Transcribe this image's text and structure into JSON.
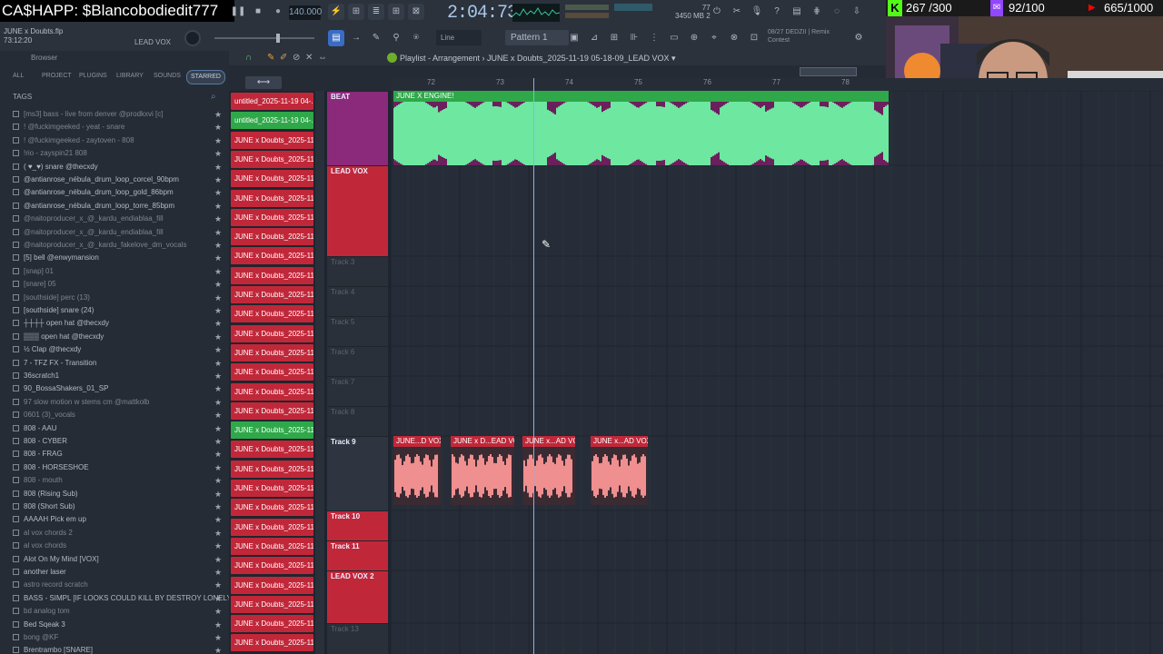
{
  "stream": {
    "cashapp": "CA$HAPP: $Blancobodiedit777",
    "goal1": "267 /300",
    "goal2": "92/100",
    "goal3": "665/1000"
  },
  "transport": {
    "tempo": "140.000",
    "time": "2:04:73",
    "time_label": "M:S:CS",
    "cpu": "3450 MB",
    "cpu2": "2",
    "cpu_top": "77"
  },
  "song": {
    "title": "JUNE x Doubts.flp",
    "elapsed": "73:12:20",
    "channel": "LEAD VOX"
  },
  "toolbar": {
    "snap": "Line",
    "pattern": "Pattern 1",
    "hint_line1": "08/27  DEDZII | Remix",
    "hint_line2": "Contest"
  },
  "browser": {
    "header": "Browser",
    "tabs": [
      "ALL",
      "PROJECT",
      "PLUGINS",
      "LIBRARY",
      "SOUNDS",
      "STARRED"
    ],
    "tags_label": "TAGS",
    "items": [
      {
        "label": "[ms3] bass - live from denver @prodkxvi [c]",
        "dim": true
      },
      {
        "label": "! @fuckimgeeked - yeat - snare",
        "dim": true
      },
      {
        "label": "! @fuckimgeeked - zaytoven - 808",
        "dim": true
      },
      {
        "label": "!rio - zayspin21 808",
        "dim": true
      },
      {
        "label": "( ♥_♥) snare @thecxdy",
        "dim": false
      },
      {
        "label": "@antianrose_nébula_drum_loop_corcel_90bpm",
        "dim": false
      },
      {
        "label": "@antianrose_nébula_drum_loop_gold_86bpm",
        "dim": false
      },
      {
        "label": "@antianrose_nébula_drum_loop_torre_85bpm",
        "dim": false
      },
      {
        "label": "@naitoproducer_x_@_kardu_endiablaa_fill",
        "dim": true
      },
      {
        "label": "@naitoproducer_x_@_kardu_endiablaa_fill",
        "dim": true
      },
      {
        "label": "@naitoproducer_x_@_kardu_fakelove_dm_vocals",
        "dim": true
      },
      {
        "label": "[5] bell @enwymansion",
        "dim": false
      },
      {
        "label": "[snap] 01",
        "dim": true
      },
      {
        "label": "[snare] 05",
        "dim": true
      },
      {
        "label": "[southside] perc (13)",
        "dim": true
      },
      {
        "label": "[southside] snare (24)",
        "dim": false
      },
      {
        "label": "┼┼┼┼ open hat @thecxdy",
        "dim": false
      },
      {
        "label": "▒▒▒ open hat @thecxdy",
        "dim": false
      },
      {
        "label": "½ Clap @thecxdy",
        "dim": false
      },
      {
        "label": "7 - TFZ FX - Transition",
        "dim": false
      },
      {
        "label": "36scratch1",
        "dim": false
      },
      {
        "label": "90_BossaShakers_01_SP",
        "dim": false
      },
      {
        "label": "97 slow motion w stems cm @mattkolb",
        "dim": true
      },
      {
        "label": "0601 (3)_vocals",
        "dim": true
      },
      {
        "label": "808 - AAU",
        "dim": false
      },
      {
        "label": "808 - CYBER",
        "dim": false
      },
      {
        "label": "808 - FRAG",
        "dim": false
      },
      {
        "label": "808 - HORSESHOE",
        "dim": false
      },
      {
        "label": "808 - mouth",
        "dim": true
      },
      {
        "label": "808 (Rising Sub)",
        "dim": false
      },
      {
        "label": "808 (Short Sub)",
        "dim": false
      },
      {
        "label": "AAAAH Pick em up",
        "dim": false
      },
      {
        "label": "al vox chords 2",
        "dim": true
      },
      {
        "label": "al vox chords",
        "dim": true
      },
      {
        "label": "Alot On My Mind [VOX]",
        "dim": false
      },
      {
        "label": "another laser",
        "dim": false
      },
      {
        "label": "astro record scratch",
        "dim": true
      },
      {
        "label": "BASS - SIMPL [IF LOOKS COULD KILL BY DESTROY LONELY]",
        "dim": false
      },
      {
        "label": "bd analog tom",
        "dim": true
      },
      {
        "label": "Bed Sqeak 3",
        "dim": false
      },
      {
        "label": "bong @KF",
        "dim": true
      },
      {
        "label": "Brentrambo [SNARE]",
        "dim": false
      }
    ]
  },
  "picker": {
    "clips": [
      {
        "label": "untitled_2025-11-19 04-...",
        "green": false
      },
      {
        "label": "untitled_2025-11-19 04-...",
        "green": true
      },
      {
        "label": "JUNE x Doubts_2025-11-...",
        "green": false
      },
      {
        "label": "JUNE x Doubts_2025-11-...",
        "green": false
      },
      {
        "label": "JUNE x Doubts_2025-11-...",
        "green": false
      },
      {
        "label": "JUNE x Doubts_2025-11-...",
        "green": false
      },
      {
        "label": "JUNE x Doubts_2025-11-...",
        "green": false
      },
      {
        "label": "JUNE x Doubts_2025-11-...",
        "green": false
      },
      {
        "label": "JUNE x Doubts_2025-11-...",
        "green": false
      },
      {
        "label": "JUNE x Doubts_2025-11-...",
        "green": false
      },
      {
        "label": "JUNE x Doubts_2025-11-...",
        "green": false
      },
      {
        "label": "JUNE x Doubts_2025-11-...",
        "green": false
      },
      {
        "label": "JUNE x Doubts_2025-11-...",
        "green": false
      },
      {
        "label": "JUNE x Doubts_2025-11-...",
        "green": false
      },
      {
        "label": "JUNE x Doubts_2025-11-...",
        "green": false
      },
      {
        "label": "JUNE x Doubts_2025-11-...",
        "green": false
      },
      {
        "label": "JUNE x Doubts_2025-11-...",
        "green": false
      },
      {
        "label": "JUNE x Doubts_2025-11-...",
        "green": true
      },
      {
        "label": "JUNE x Doubts_2025-11-...",
        "green": false
      },
      {
        "label": "JUNE x Doubts_2025-11-...",
        "green": false
      },
      {
        "label": "JUNE x Doubts_2025-11-...",
        "green": false
      },
      {
        "label": "JUNE x Doubts_2025-11-...",
        "green": false
      },
      {
        "label": "JUNE x Doubts_2025-11-...",
        "green": false
      },
      {
        "label": "JUNE x Doubts_2025-11-...",
        "green": false
      },
      {
        "label": "JUNE x Doubts_2025-11-...",
        "green": false
      },
      {
        "label": "JUNE x Doubts_2025-11-...",
        "green": false
      },
      {
        "label": "JUNE x Doubts_2025-11-...",
        "green": false
      },
      {
        "label": "JUNE x Doubts_2025-11-...",
        "green": false
      },
      {
        "label": "JUNE x Doubts_2025-11-...",
        "green": false
      }
    ]
  },
  "playlist": {
    "title": "Playlist - Arrangement › JUNE x Doubts_2025-11-19 05-18-09_LEAD VOX ▾",
    "ticks": [
      "72",
      "73",
      "74",
      "75",
      "76",
      "77",
      "78"
    ],
    "tracks": [
      "BEAT",
      "LEAD VOX",
      "Track 3",
      "Track 4",
      "Track 5",
      "Track 6",
      "Track 7",
      "Track 8",
      "Track 9",
      "Track 10",
      "Track 11",
      "LEAD VOX 2",
      "Track 13"
    ],
    "beat_clip": "JUNE X ENGINE!",
    "vox_clips": [
      "JUNE...D VOX",
      "JUNE x D...EAD VOX",
      "JUNE x...AD VOX",
      "JUNE x...AD VOX"
    ]
  },
  "colors": {
    "beat": "#6ee7a0",
    "vox": "#f08f8f",
    "clip_red": "#c0283a",
    "clip_green": "#2fa84a",
    "accent": "#8ab1e3"
  }
}
